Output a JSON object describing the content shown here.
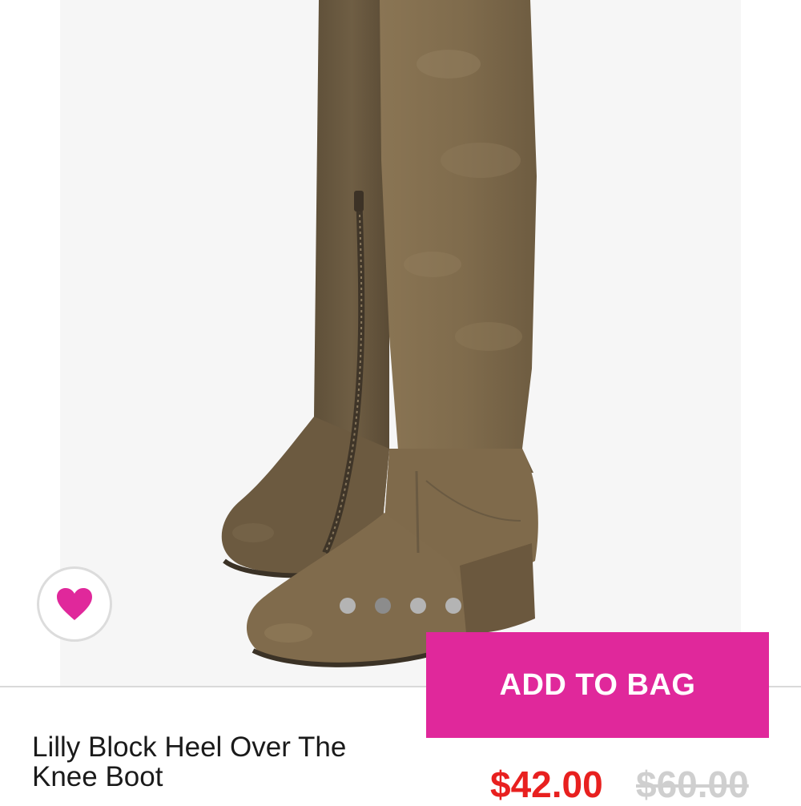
{
  "product": {
    "title": "Lilly Block Heel Over The Knee Boot",
    "price_current": "$42.00",
    "price_original": "$60.00",
    "image_subject": "over-the-knee suede boots"
  },
  "actions": {
    "add_to_bag_label": "ADD TO BAG",
    "wishlist_icon": "heart-icon"
  },
  "carousel": {
    "slide_count": 4,
    "active_index": 1
  },
  "colors": {
    "accent": "#e0289b",
    "price_sale": "#e8201f",
    "price_original": "#cfcfcf",
    "image_background": "#f6f6f6",
    "boot_suede": "#7d6a4d"
  }
}
